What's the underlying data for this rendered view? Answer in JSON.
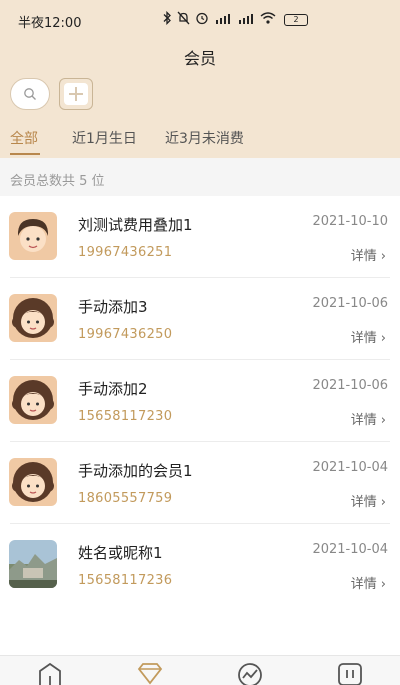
{
  "status_bar": {
    "time": "半夜12:00",
    "battery": "2"
  },
  "header": {
    "title": "会员"
  },
  "tabs": [
    {
      "label": "全部",
      "active": true
    },
    {
      "label": "近1月生日",
      "active": false
    },
    {
      "label": "近3月未消费",
      "active": false
    }
  ],
  "summary": {
    "text": "会员总数共 5 位"
  },
  "members": [
    {
      "name": "刘测试费用叠加1",
      "phone": "19967436251",
      "date": "2021-10-10",
      "detail": "详情",
      "avatar": "male-avatar"
    },
    {
      "name": "手动添加3",
      "phone": "19967436250",
      "date": "2021-10-06",
      "detail": "详情",
      "avatar": "female-avatar"
    },
    {
      "name": "手动添加2",
      "phone": "15658117230",
      "date": "2021-10-06",
      "detail": "详情",
      "avatar": "female-avatar"
    },
    {
      "name": "手动添加的会员1",
      "phone": "18605557759",
      "date": "2021-10-04",
      "detail": "详情",
      "avatar": "female-avatar"
    },
    {
      "name": "姓名或昵称1",
      "phone": "15658117236",
      "date": "2021-10-04",
      "detail": "详情",
      "avatar": "photo-avatar"
    }
  ],
  "colors": {
    "header_bg": "#f3e5d2",
    "accent": "#b8874c",
    "phone": "#c29a5c"
  },
  "bottom_nav": [
    {
      "icon": "home-icon",
      "active": false
    },
    {
      "icon": "member-diamond-icon",
      "active": true
    },
    {
      "icon": "chart-icon",
      "active": false
    },
    {
      "icon": "pause-icon",
      "active": false
    }
  ]
}
